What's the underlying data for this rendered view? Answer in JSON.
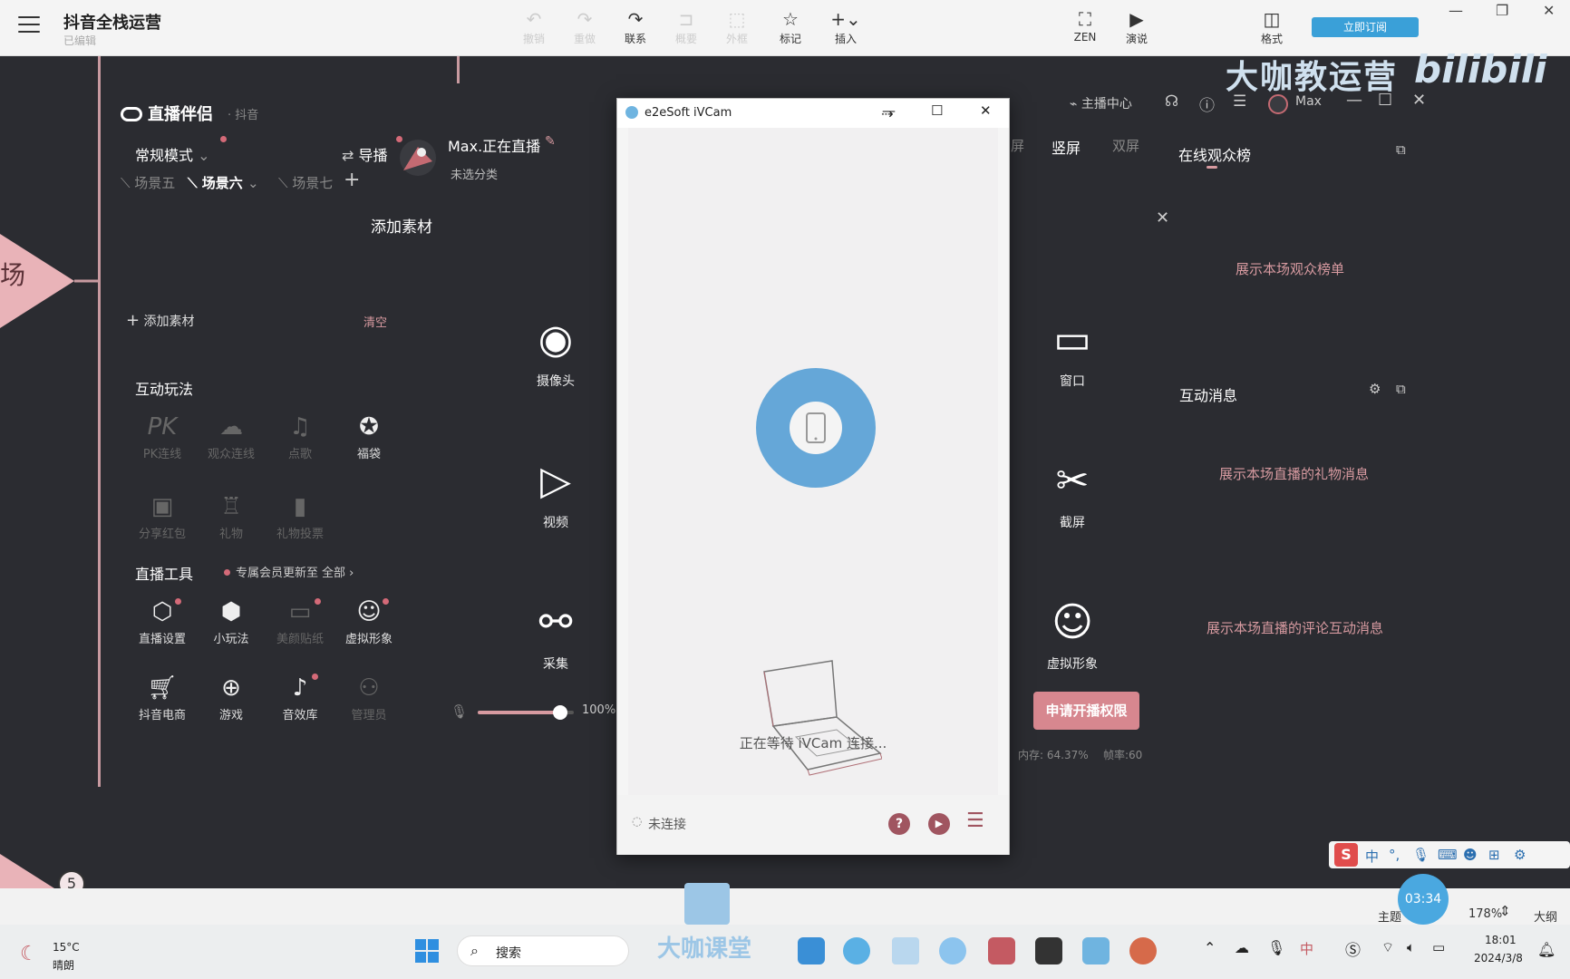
{
  "topbar": {
    "title": "抖音全栈运营",
    "subtitle": "已编辑",
    "buttons": [
      {
        "label": "撤销",
        "icon": "undo-icon",
        "dim": true
      },
      {
        "label": "重做",
        "icon": "redo-icon",
        "dim": true
      },
      {
        "label": "联系",
        "icon": "link-icon",
        "dim": false
      },
      {
        "label": "概要",
        "icon": "summary-icon",
        "dim": true
      },
      {
        "label": "外框",
        "icon": "frame-icon",
        "dim": true
      },
      {
        "label": "标记",
        "icon": "star-icon",
        "dim": false
      },
      {
        "label": "插入",
        "icon": "plus-icon",
        "dim": false
      }
    ],
    "zen_label": "ZEN",
    "present_label": "演说",
    "format_label": "格式",
    "subscribe_label": "立即订阅"
  },
  "watermark": {
    "text": "大咖教运营",
    "bili": "bilibili"
  },
  "live": {
    "brand": "直播伴侣",
    "brand_sub": "· 抖音",
    "mode": "常规模式",
    "broadcast": "导播",
    "streamer": "Max.正在直播",
    "category": "未选分类",
    "scenes": [
      "场景五",
      "场景六",
      "场景七"
    ],
    "add_material_title": "添加素材",
    "add_material": "添加素材",
    "clear": "清空",
    "interactive_title": "互动玩法",
    "interactive": [
      {
        "label": "PK连线",
        "icon": "pk-icon",
        "dim": true
      },
      {
        "label": "观众连线",
        "icon": "audience-link-icon",
        "dim": true
      },
      {
        "label": "点歌",
        "icon": "music-icon",
        "dim": true
      },
      {
        "label": "福袋",
        "icon": "lucky-bag-icon",
        "dim": false
      },
      {
        "label": "分享红包",
        "icon": "red-packet-icon",
        "dim": true
      },
      {
        "label": "礼物",
        "icon": "gift-icon",
        "dim": true
      },
      {
        "label": "礼物投票",
        "icon": "vote-icon",
        "dim": true
      }
    ],
    "tools_title": "直播工具",
    "tools_notice": "专属会员更新至",
    "tools_all": "全部",
    "tools": [
      {
        "label": "直播设置",
        "icon": "settings-hex-icon",
        "dim": false
      },
      {
        "label": "小玩法",
        "icon": "mini-game-icon",
        "dim": false
      },
      {
        "label": "美颜贴纸",
        "icon": "beauty-icon",
        "dim": true
      },
      {
        "label": "虚拟形象",
        "icon": "avatar-icon",
        "dim": false
      },
      {
        "label": "抖音电商",
        "icon": "cart-icon",
        "dim": false
      },
      {
        "label": "游戏",
        "icon": "gamepad-icon",
        "dim": false
      },
      {
        "label": "音效库",
        "icon": "sound-effect-icon",
        "dim": false
      },
      {
        "label": "管理员",
        "icon": "admin-icon",
        "dim": true
      }
    ],
    "sources_left": [
      {
        "label": "摄像头",
        "icon": "webcam-icon"
      },
      {
        "label": "视频",
        "icon": "play-circle-icon"
      },
      {
        "label": "采集",
        "icon": "capture-icon"
      }
    ],
    "sources_right": [
      {
        "label": "窗口",
        "icon": "window-icon"
      },
      {
        "label": "截屏",
        "icon": "scissors-icon"
      },
      {
        "label": "虚拟形象",
        "icon": "virtual-avatar-icon"
      }
    ],
    "volume": "100%",
    "volume_level": 0.86,
    "orient_h": "屏",
    "orient_v": "竖屏",
    "orient_dual": "双屏",
    "host_center": "主播中心",
    "user": "Max",
    "audience_rank": "在线观众榜",
    "audience_rank_hint": "展示本场观众榜单",
    "messages_title": "互动消息",
    "gift_hint": "展示本场直播的礼物消息",
    "comment_hint": "展示本场直播的评论互动消息",
    "apply_button": "申请开播权限",
    "memory": "内存: 64.37%",
    "fps": "帧率:60"
  },
  "ivcam": {
    "title": "e2eSoft iVCam",
    "waiting": "正在等待 iVCam 连接...",
    "status": "未连接"
  },
  "mindmap": {
    "node_partial": "场",
    "node_number": "5"
  },
  "status_bar": {
    "theme": "主题",
    "timer": "03:34",
    "zoom": "178%",
    "outline": "大纲"
  },
  "taskbar": {
    "weather_temp": "15°C",
    "weather_desc": "晴朗",
    "search": "搜索",
    "overlay": "大咖课堂",
    "time": "18:01",
    "date": "2024/3/8",
    "ime_lang": "中"
  }
}
